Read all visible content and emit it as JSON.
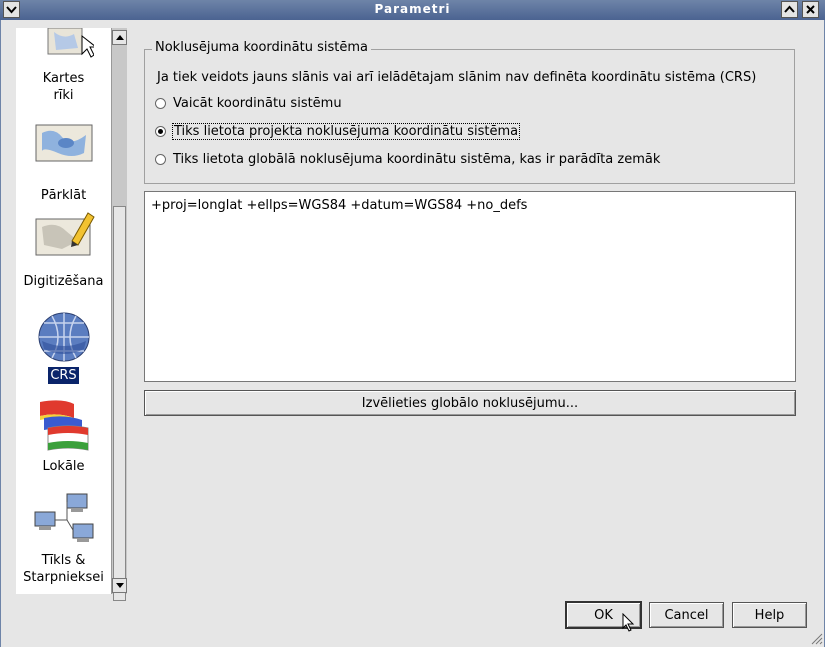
{
  "window": {
    "title": "Parametri"
  },
  "sidebar": {
    "items": [
      {
        "label_lines": [
          "Kartes",
          "rīki"
        ],
        "icon": "map-tools-icon"
      },
      {
        "label_lines": [
          "Pārklāt"
        ],
        "icon": "overlay-map-icon"
      },
      {
        "label_lines": [
          "Digitizēšana"
        ],
        "icon": "digitizing-pencil-icon"
      },
      {
        "label_lines": [
          "CRS"
        ],
        "icon": "globe-crs-icon",
        "selected": true
      },
      {
        "label_lines": [
          "Lokāle"
        ],
        "icon": "locale-flags-icon"
      },
      {
        "label_lines": [
          "Tīkls &",
          "Starpnieksei"
        ],
        "icon": "network-proxy-icon"
      }
    ]
  },
  "crs_group": {
    "title": "Noklusējuma koordinātu sistēma",
    "description": "Ja tiek veidots jauns slānis vai arī ielādētajam slānim nav definēta koordinātu sistēma (CRS)",
    "options": [
      {
        "label": "Vaicāt koordinātu sistēmu",
        "checked": false
      },
      {
        "label": "Tiks lietota projekta noklusējuma koordinātu sistēma",
        "checked": true
      },
      {
        "label": "Tiks lietota globālā noklusējuma koordinātu sistēma, kas ir parādīta zemāk",
        "checked": false
      }
    ]
  },
  "crs_text": "+proj=longlat +ellps=WGS84 +datum=WGS84 +no_defs",
  "select_global_button": "Izvēlieties globālo noklusējumu...",
  "buttons": {
    "ok": "OK",
    "cancel": "Cancel",
    "help": "Help"
  }
}
